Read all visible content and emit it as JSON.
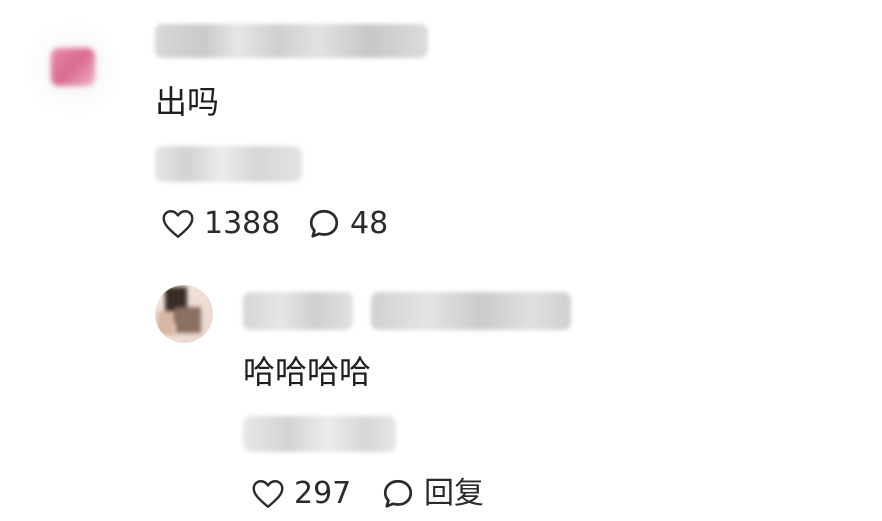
{
  "comment": {
    "text": "出吗",
    "likes": "1388",
    "replies": "48"
  },
  "reply": {
    "text": "哈哈哈哈",
    "likes": "297",
    "reply_label": "回复"
  },
  "icons": {
    "like": "heart-outline-icon",
    "comment": "speech-bubble-icon"
  },
  "colors": {
    "text": "#1f1f1f",
    "muted": "#2b2b2b",
    "background": "#ffffff"
  }
}
